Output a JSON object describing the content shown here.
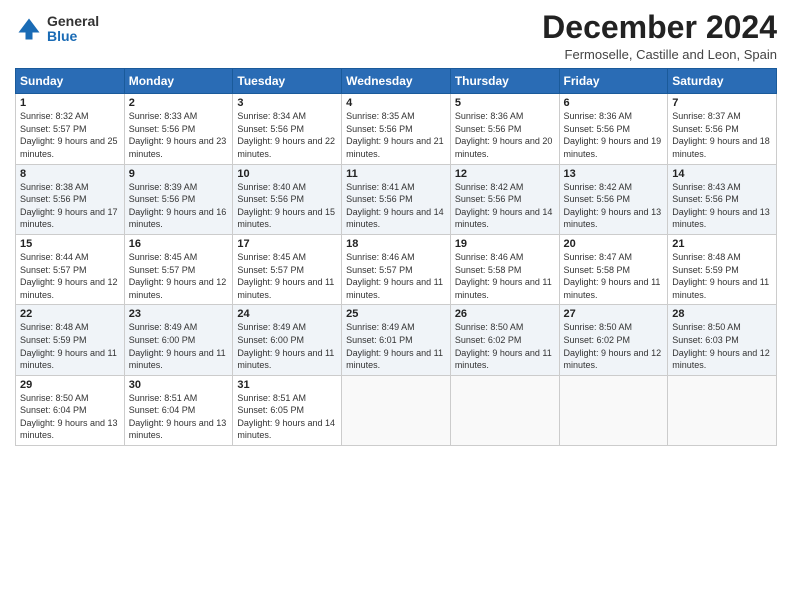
{
  "logo": {
    "general": "General",
    "blue": "Blue"
  },
  "header": {
    "month": "December 2024",
    "location": "Fermoselle, Castille and Leon, Spain"
  },
  "weekdays": [
    "Sunday",
    "Monday",
    "Tuesday",
    "Wednesday",
    "Thursday",
    "Friday",
    "Saturday"
  ],
  "weeks": [
    [
      {
        "day": "1",
        "sunrise": "Sunrise: 8:32 AM",
        "sunset": "Sunset: 5:57 PM",
        "daylight": "Daylight: 9 hours and 25 minutes."
      },
      {
        "day": "2",
        "sunrise": "Sunrise: 8:33 AM",
        "sunset": "Sunset: 5:56 PM",
        "daylight": "Daylight: 9 hours and 23 minutes."
      },
      {
        "day": "3",
        "sunrise": "Sunrise: 8:34 AM",
        "sunset": "Sunset: 5:56 PM",
        "daylight": "Daylight: 9 hours and 22 minutes."
      },
      {
        "day": "4",
        "sunrise": "Sunrise: 8:35 AM",
        "sunset": "Sunset: 5:56 PM",
        "daylight": "Daylight: 9 hours and 21 minutes."
      },
      {
        "day": "5",
        "sunrise": "Sunrise: 8:36 AM",
        "sunset": "Sunset: 5:56 PM",
        "daylight": "Daylight: 9 hours and 20 minutes."
      },
      {
        "day": "6",
        "sunrise": "Sunrise: 8:36 AM",
        "sunset": "Sunset: 5:56 PM",
        "daylight": "Daylight: 9 hours and 19 minutes."
      },
      {
        "day": "7",
        "sunrise": "Sunrise: 8:37 AM",
        "sunset": "Sunset: 5:56 PM",
        "daylight": "Daylight: 9 hours and 18 minutes."
      }
    ],
    [
      {
        "day": "8",
        "sunrise": "Sunrise: 8:38 AM",
        "sunset": "Sunset: 5:56 PM",
        "daylight": "Daylight: 9 hours and 17 minutes."
      },
      {
        "day": "9",
        "sunrise": "Sunrise: 8:39 AM",
        "sunset": "Sunset: 5:56 PM",
        "daylight": "Daylight: 9 hours and 16 minutes."
      },
      {
        "day": "10",
        "sunrise": "Sunrise: 8:40 AM",
        "sunset": "Sunset: 5:56 PM",
        "daylight": "Daylight: 9 hours and 15 minutes."
      },
      {
        "day": "11",
        "sunrise": "Sunrise: 8:41 AM",
        "sunset": "Sunset: 5:56 PM",
        "daylight": "Daylight: 9 hours and 14 minutes."
      },
      {
        "day": "12",
        "sunrise": "Sunrise: 8:42 AM",
        "sunset": "Sunset: 5:56 PM",
        "daylight": "Daylight: 9 hours and 14 minutes."
      },
      {
        "day": "13",
        "sunrise": "Sunrise: 8:42 AM",
        "sunset": "Sunset: 5:56 PM",
        "daylight": "Daylight: 9 hours and 13 minutes."
      },
      {
        "day": "14",
        "sunrise": "Sunrise: 8:43 AM",
        "sunset": "Sunset: 5:56 PM",
        "daylight": "Daylight: 9 hours and 13 minutes."
      }
    ],
    [
      {
        "day": "15",
        "sunrise": "Sunrise: 8:44 AM",
        "sunset": "Sunset: 5:57 PM",
        "daylight": "Daylight: 9 hours and 12 minutes."
      },
      {
        "day": "16",
        "sunrise": "Sunrise: 8:45 AM",
        "sunset": "Sunset: 5:57 PM",
        "daylight": "Daylight: 9 hours and 12 minutes."
      },
      {
        "day": "17",
        "sunrise": "Sunrise: 8:45 AM",
        "sunset": "Sunset: 5:57 PM",
        "daylight": "Daylight: 9 hours and 11 minutes."
      },
      {
        "day": "18",
        "sunrise": "Sunrise: 8:46 AM",
        "sunset": "Sunset: 5:57 PM",
        "daylight": "Daylight: 9 hours and 11 minutes."
      },
      {
        "day": "19",
        "sunrise": "Sunrise: 8:46 AM",
        "sunset": "Sunset: 5:58 PM",
        "daylight": "Daylight: 9 hours and 11 minutes."
      },
      {
        "day": "20",
        "sunrise": "Sunrise: 8:47 AM",
        "sunset": "Sunset: 5:58 PM",
        "daylight": "Daylight: 9 hours and 11 minutes."
      },
      {
        "day": "21",
        "sunrise": "Sunrise: 8:48 AM",
        "sunset": "Sunset: 5:59 PM",
        "daylight": "Daylight: 9 hours and 11 minutes."
      }
    ],
    [
      {
        "day": "22",
        "sunrise": "Sunrise: 8:48 AM",
        "sunset": "Sunset: 5:59 PM",
        "daylight": "Daylight: 9 hours and 11 minutes."
      },
      {
        "day": "23",
        "sunrise": "Sunrise: 8:49 AM",
        "sunset": "Sunset: 6:00 PM",
        "daylight": "Daylight: 9 hours and 11 minutes."
      },
      {
        "day": "24",
        "sunrise": "Sunrise: 8:49 AM",
        "sunset": "Sunset: 6:00 PM",
        "daylight": "Daylight: 9 hours and 11 minutes."
      },
      {
        "day": "25",
        "sunrise": "Sunrise: 8:49 AM",
        "sunset": "Sunset: 6:01 PM",
        "daylight": "Daylight: 9 hours and 11 minutes."
      },
      {
        "day": "26",
        "sunrise": "Sunrise: 8:50 AM",
        "sunset": "Sunset: 6:02 PM",
        "daylight": "Daylight: 9 hours and 11 minutes."
      },
      {
        "day": "27",
        "sunrise": "Sunrise: 8:50 AM",
        "sunset": "Sunset: 6:02 PM",
        "daylight": "Daylight: 9 hours and 12 minutes."
      },
      {
        "day": "28",
        "sunrise": "Sunrise: 8:50 AM",
        "sunset": "Sunset: 6:03 PM",
        "daylight": "Daylight: 9 hours and 12 minutes."
      }
    ],
    [
      {
        "day": "29",
        "sunrise": "Sunrise: 8:50 AM",
        "sunset": "Sunset: 6:04 PM",
        "daylight": "Daylight: 9 hours and 13 minutes."
      },
      {
        "day": "30",
        "sunrise": "Sunrise: 8:51 AM",
        "sunset": "Sunset: 6:04 PM",
        "daylight": "Daylight: 9 hours and 13 minutes."
      },
      {
        "day": "31",
        "sunrise": "Sunrise: 8:51 AM",
        "sunset": "Sunset: 6:05 PM",
        "daylight": "Daylight: 9 hours and 14 minutes."
      },
      null,
      null,
      null,
      null
    ]
  ]
}
